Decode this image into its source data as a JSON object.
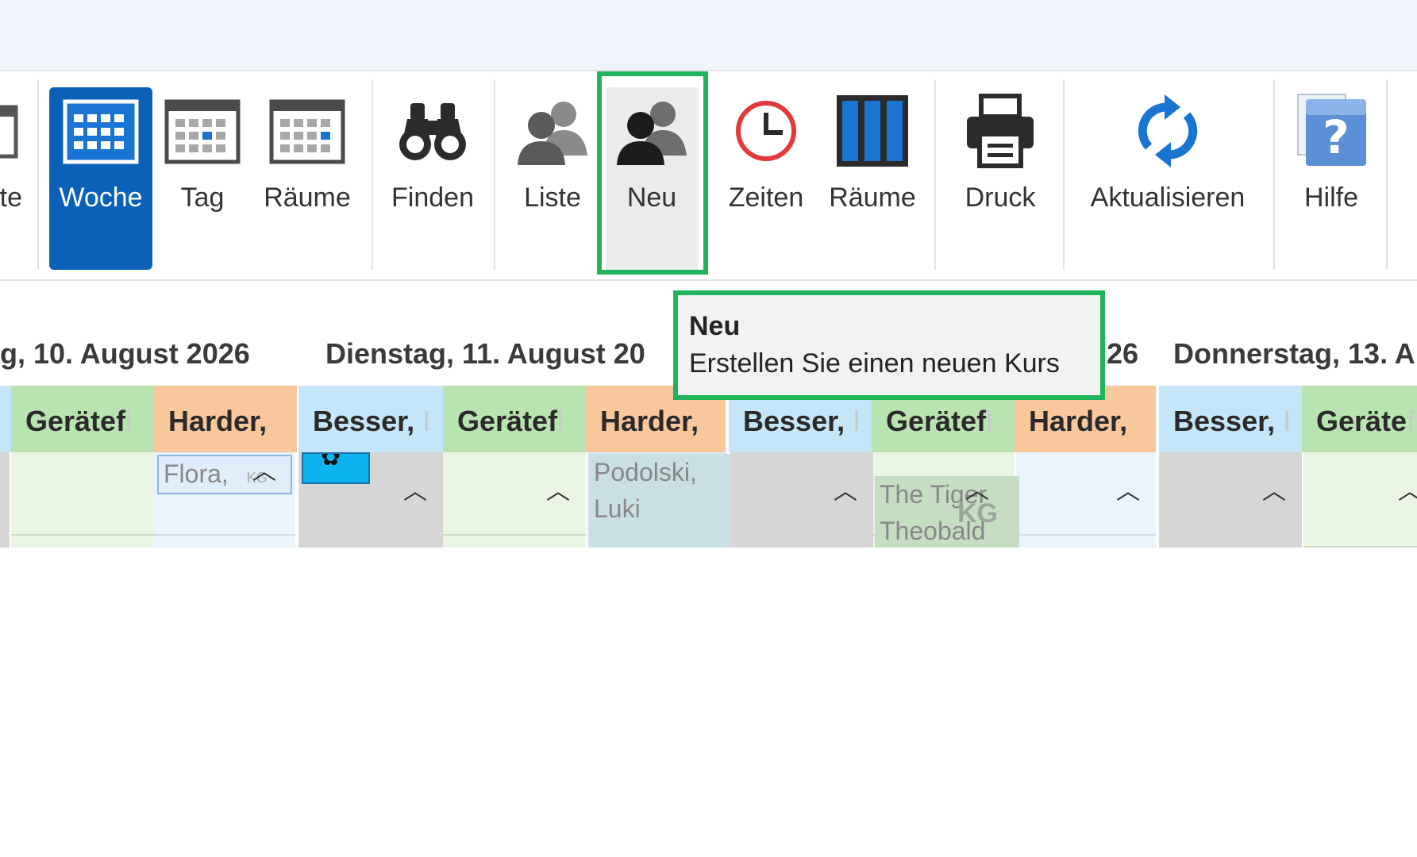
{
  "ribbon": {
    "cut_left_label": "te",
    "buttons": [
      {
        "label": "Woche",
        "icon": "calendar-week-icon"
      },
      {
        "label": "Tag",
        "icon": "calendar-day-icon"
      },
      {
        "label": "Räume",
        "icon": "calendar-rooms-icon"
      },
      {
        "label": "Finden",
        "icon": "binoculars-icon"
      },
      {
        "label": "Liste",
        "icon": "people-list-icon"
      },
      {
        "label": "Neu",
        "icon": "people-new-icon"
      },
      {
        "label": "Zeiten",
        "icon": "clock-icon"
      },
      {
        "label": "Räume",
        "icon": "columns-rooms-icon"
      },
      {
        "label": "Druck",
        "icon": "printer-icon"
      },
      {
        "label": "Aktualisieren",
        "icon": "refresh-icon"
      },
      {
        "label": "Hilfe",
        "icon": "help-icon"
      }
    ],
    "active": "Woche",
    "hovered": "Neu"
  },
  "tooltip": {
    "title": "Neu",
    "description": "Erstellen Sie einen neuen Kurs"
  },
  "days": [
    {
      "label": "g, 10. August 2026"
    },
    {
      "label": "Dienstag, 11. August 20"
    },
    {
      "label": "26"
    },
    {
      "label": "Donnerstag, 13. A"
    }
  ],
  "resources": [
    {
      "name": "Gerätef",
      "fade": "l"
    },
    {
      "name": "Harder,",
      "fade": ""
    },
    {
      "name": "Besser,",
      "fade": "I"
    },
    {
      "name": "Gerätef",
      "fade": "l"
    },
    {
      "name": "Harder,",
      "fade": ""
    },
    {
      "name": "Besser,",
      "fade": "I"
    },
    {
      "name": "Gerätef",
      "fade": "l"
    },
    {
      "name": "Harder,",
      "fade": ""
    },
    {
      "name": "Besser,",
      "fade": "I"
    },
    {
      "name": "Geräte",
      "fade": "f"
    }
  ],
  "events": [
    {
      "text": "Flora,",
      "badge": "KG"
    },
    {
      "text": "Podolski, Luki"
    },
    {
      "text": "The Tiger Theobald",
      "badge": "KG"
    }
  ],
  "colors": {
    "accent_blue": "#0b61b8",
    "highlight_green": "#1fb45a",
    "header_green": "#b9e3b1",
    "header_orange": "#f9c79c",
    "header_blue": "#c4e6f8"
  }
}
